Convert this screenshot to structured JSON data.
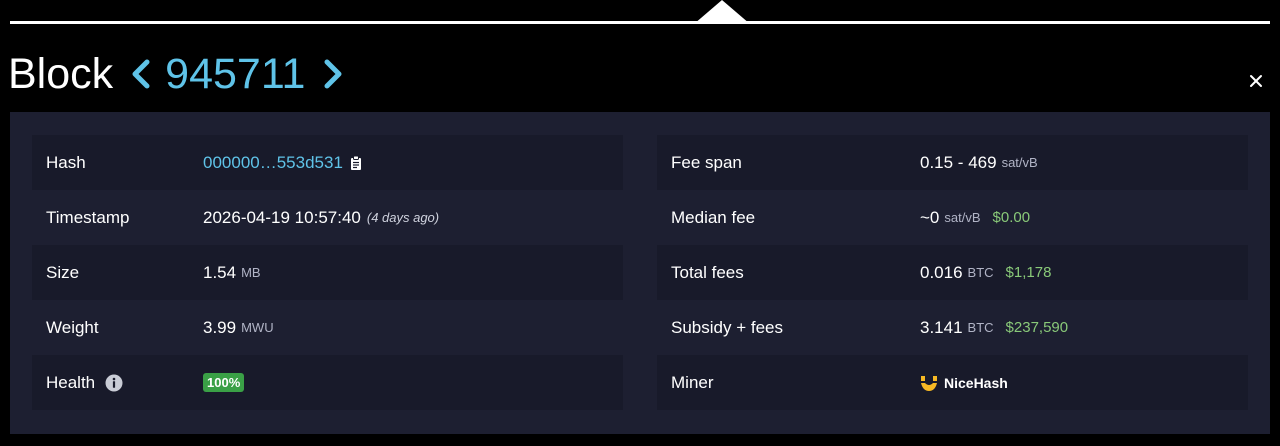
{
  "header": {
    "title": "Block",
    "block_number": "945711"
  },
  "left_rows": {
    "hash": {
      "label": "Hash",
      "value": "000000…553d531"
    },
    "timestamp": {
      "label": "Timestamp",
      "value": "2026-04-19 10:57:40",
      "relative": "(4 days ago)"
    },
    "size": {
      "label": "Size",
      "value": "1.54",
      "unit": "MB"
    },
    "weight": {
      "label": "Weight",
      "value": "3.99",
      "unit": "MWU"
    },
    "health": {
      "label": "Health",
      "value": "100%"
    }
  },
  "right_rows": {
    "fee_span": {
      "label": "Fee span",
      "value": "0.15 - 469",
      "unit": "sat/vB"
    },
    "median_fee": {
      "label": "Median fee",
      "value": "~0",
      "unit": "sat/vB",
      "fiat": "$0.00"
    },
    "total_fees": {
      "label": "Total fees",
      "value": "0.016",
      "unit": "BTC",
      "fiat": "$1,178"
    },
    "subsidy_fees": {
      "label": "Subsidy + fees",
      "value": "3.141",
      "unit": "BTC",
      "fiat": "$237,590"
    },
    "miner": {
      "label": "Miner",
      "value": "NiceHash"
    }
  },
  "icons": {
    "prev": "chevron-left-icon",
    "next": "chevron-right-icon",
    "close": "close-icon",
    "copy": "clipboard-icon",
    "info": "info-icon",
    "miner": "nicehash-logo-icon"
  },
  "colors": {
    "accent": "#5fc3e8",
    "fiat": "#89c979",
    "badge": "#3aa046",
    "panel": "#1d1f31",
    "row_alt": "#181a2a"
  }
}
